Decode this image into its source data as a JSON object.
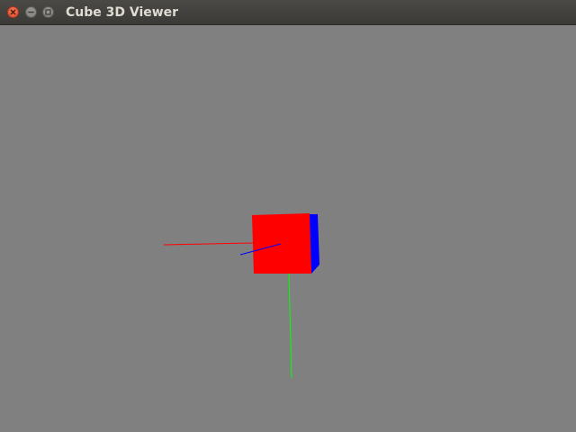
{
  "window": {
    "title": "Cube 3D Viewer",
    "controls": [
      "close",
      "minimize",
      "maximize"
    ]
  },
  "scene": {
    "background_color": "#808080",
    "axes": {
      "x_color": "#ff0000",
      "y_color": "#00ff00",
      "z_color": "#0000ff"
    },
    "cube_front_color": "#ff0000",
    "cube_side_color": "#0000ff"
  }
}
